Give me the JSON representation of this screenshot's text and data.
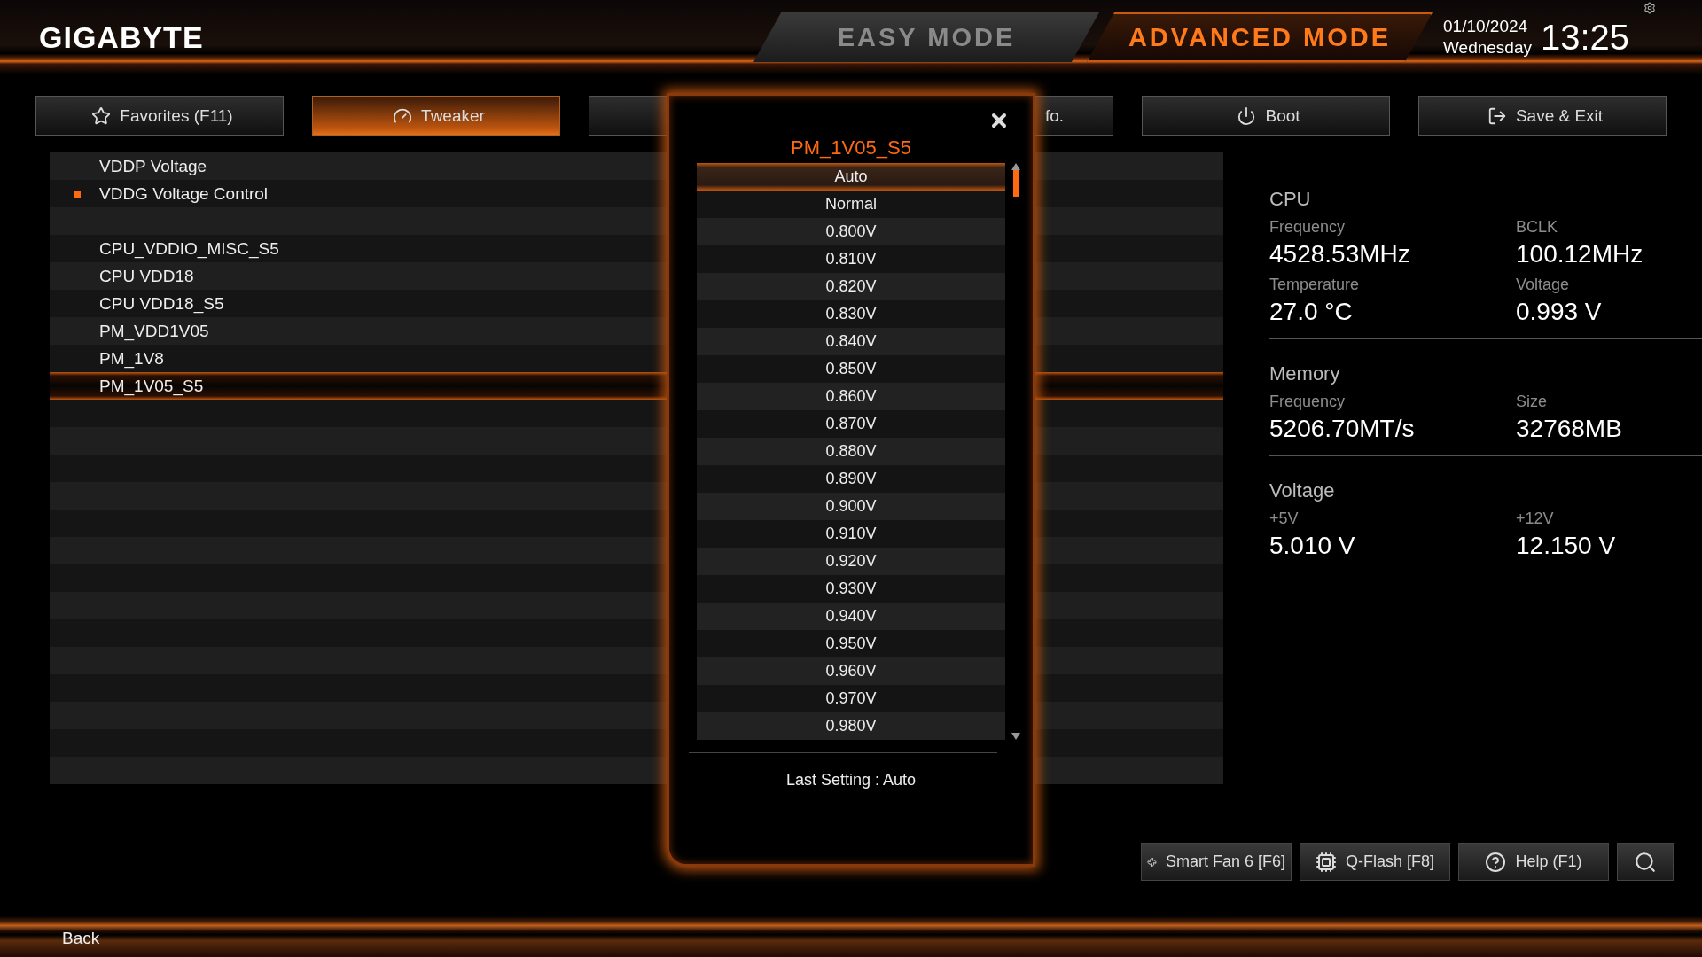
{
  "header": {
    "logo": "GIGABYTE",
    "modes": [
      {
        "label": "EASY MODE",
        "selected": false
      },
      {
        "label": "ADVANCED MODE",
        "selected": true
      }
    ],
    "date": "01/10/2024",
    "day": "Wednesday",
    "time": "13:25"
  },
  "tabs": [
    {
      "label": "Favorites (F11)",
      "selected": false
    },
    {
      "label": "Tweaker",
      "selected": true
    },
    {
      "selected": false
    },
    {
      "label": "fo.",
      "selected": false
    },
    {
      "label": "Boot",
      "selected": false
    },
    {
      "label": "Save & Exit",
      "selected": false
    }
  ],
  "settings": [
    {
      "kind": "setting",
      "label": "VDDP Voltage",
      "marked": false,
      "selected": false
    },
    {
      "kind": "setting",
      "label": "VDDG Voltage Control",
      "marked": true,
      "selected": false
    },
    {
      "kind": "spacer"
    },
    {
      "kind": "setting",
      "label": "CPU_VDDIO_MISC_S5",
      "marked": false,
      "selected": false
    },
    {
      "kind": "setting",
      "label": "CPU VDD18",
      "marked": false,
      "selected": false
    },
    {
      "kind": "setting",
      "label": "CPU VDD18_S5",
      "marked": false,
      "selected": false
    },
    {
      "kind": "setting",
      "label": "PM_VDD1V05",
      "marked": false,
      "selected": false
    },
    {
      "kind": "setting",
      "label": "PM_1V8",
      "marked": false,
      "selected": false
    },
    {
      "kind": "setting",
      "label": "PM_1V05_S5",
      "marked": false,
      "selected": true
    }
  ],
  "popup": {
    "title": "PM_1V05_S5",
    "options": [
      {
        "label": "Auto",
        "selected": true
      },
      {
        "label": "Normal",
        "selected": false
      },
      {
        "label": "0.800V",
        "selected": false
      },
      {
        "label": "0.810V",
        "selected": false
      },
      {
        "label": "0.820V",
        "selected": false
      },
      {
        "label": "0.830V",
        "selected": false
      },
      {
        "label": "0.840V",
        "selected": false
      },
      {
        "label": "0.850V",
        "selected": false
      },
      {
        "label": "0.860V",
        "selected": false
      },
      {
        "label": "0.870V",
        "selected": false
      },
      {
        "label": "0.880V",
        "selected": false
      },
      {
        "label": "0.890V",
        "selected": false
      },
      {
        "label": "0.900V",
        "selected": false
      },
      {
        "label": "0.910V",
        "selected": false
      },
      {
        "label": "0.920V",
        "selected": false
      },
      {
        "label": "0.930V",
        "selected": false
      },
      {
        "label": "0.940V",
        "selected": false
      },
      {
        "label": "0.950V",
        "selected": false
      },
      {
        "label": "0.960V",
        "selected": false
      },
      {
        "label": "0.970V",
        "selected": false
      },
      {
        "label": "0.980V",
        "selected": false
      }
    ],
    "last_setting": "Last Setting : Auto"
  },
  "system_info": [
    {
      "title": "CPU",
      "fields": [
        {
          "label": "Frequency",
          "value": "4528.53MHz"
        },
        {
          "label": "BCLK",
          "value": "100.12MHz"
        },
        {
          "label": "Temperature",
          "value": "27.0 °C"
        },
        {
          "label": "Voltage",
          "value": "0.993 V"
        }
      ]
    },
    {
      "title": "Memory",
      "fields": [
        {
          "label": "Frequency",
          "value": "5206.70MT/s"
        },
        {
          "label": "Size",
          "value": "32768MB"
        }
      ]
    },
    {
      "title": "Voltage",
      "fields": [
        {
          "label": "+5V",
          "value": "5.010 V"
        },
        {
          "label": "+12V",
          "value": "12.150 V"
        }
      ]
    }
  ],
  "tool_buttons": [
    {
      "label": "Smart Fan 6 [F6]"
    },
    {
      "label": "Q-Flash [F8]"
    },
    {
      "label": "Help (F1)"
    }
  ],
  "footer": {
    "back": "Back"
  }
}
